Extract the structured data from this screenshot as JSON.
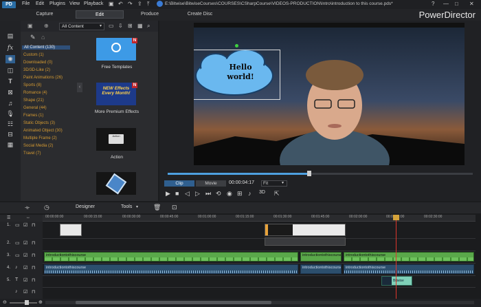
{
  "app": {
    "logo": "PD",
    "brand": "PowerDirector"
  },
  "menu": [
    "File",
    "Edit",
    "Plugins",
    "View",
    "Playback"
  ],
  "title_path": "E:\\Bitwise\\BitwiseCourses\\COURSES\\CSharpCourse\\VIDEOS-PRODUCTION\\Intro\\introduction to this course.pds*",
  "window_controls": [
    "?",
    "—",
    "□",
    "✕"
  ],
  "mode_tabs": [
    {
      "label": "Capture"
    },
    {
      "label": "Edit"
    },
    {
      "label": "Produce"
    },
    {
      "label": "Create Disc"
    }
  ],
  "library": {
    "filter": "All Content",
    "categories": [
      "All Content (130)",
      "Custom (1)",
      "Downloaded (0)",
      "3D/3D-Like (2)",
      "Paint Animations (26)",
      "Sports (8)",
      "Romance (4)",
      "Shape (21)",
      "General (44)",
      "Frames (1)",
      "Static Objects (3)",
      "Animated Object (30)",
      "Multiple Frame (2)",
      "Social Media (2)",
      "Travel (7)"
    ],
    "tiles": [
      {
        "label": "Free Templates",
        "badge": "N"
      },
      {
        "label": "More Premium Effects",
        "badge": "N",
        "art_text": "NEW Effects Every Month!"
      },
      {
        "label": "Action",
        "badge": "",
        "art_text": "Action"
      },
      {
        "label": "",
        "badge": ""
      }
    ]
  },
  "preview": {
    "bubble_text_1": "Hello",
    "bubble_text_2": "world!",
    "clip_label": "Clip",
    "movie_label": "Movie",
    "timecode": "00:00:04:17",
    "fit": "Fit",
    "mode_3d": "3D",
    "scrub_progress": 0.46
  },
  "timeline_toolbar": {
    "designer": "Designer",
    "tools": "Tools"
  },
  "ruler_ticks": [
    "00:00:00:00",
    "00:00:15:00",
    "00:00:30:00",
    "00:00:45:00",
    "00:01:00:00",
    "00:01:15:00",
    "00:01:30:00",
    "00:01:45:00",
    "00:02:00:00",
    "00:02:15:00",
    "00:02:30:00"
  ],
  "tracks": [
    "1.",
    "2.",
    "3.",
    "4.",
    "5."
  ],
  "clips": {
    "video_name": "introductiontothiscourse",
    "audio_name": "introductiontothiscourse",
    "title_clip": "Bitwise"
  }
}
